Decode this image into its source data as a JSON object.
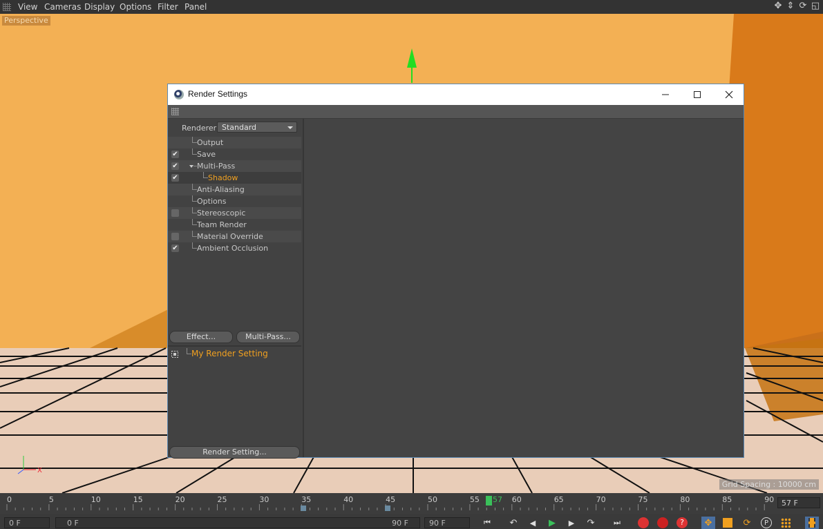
{
  "menu": {
    "items": [
      "View",
      "Cameras",
      "Display",
      "Options",
      "Filter",
      "Panel"
    ]
  },
  "viewport": {
    "camera_label": "Perspective",
    "grid_spacing": "Grid Spacing : 10000 cm",
    "axis_x": "X"
  },
  "dialog": {
    "title": "Render Settings",
    "renderer_label": "Renderer",
    "renderer_value": "Standard",
    "tree": [
      {
        "label": "Output",
        "check": "none"
      },
      {
        "label": "Save",
        "check": "on"
      },
      {
        "label": "Multi-Pass",
        "check": "on",
        "expanded": true
      },
      {
        "label": "Shadow",
        "check": "on",
        "child": true,
        "active": true
      },
      {
        "label": "Anti-Aliasing",
        "check": "none"
      },
      {
        "label": "Options",
        "check": "none"
      },
      {
        "label": "Stereoscopic",
        "check": "off"
      },
      {
        "label": "Team Render",
        "check": "none"
      },
      {
        "label": "Material Override",
        "check": "off"
      },
      {
        "label": "Ambient Occlusion",
        "check": "on"
      }
    ],
    "effect_button": "Effect...",
    "multipass_button": "Multi-Pass...",
    "setting_name": "My Render Setting",
    "render_setting_button": "Render Setting..."
  },
  "timeline": {
    "ticks": [
      "0",
      "5",
      "10",
      "15",
      "20",
      "25",
      "30",
      "35",
      "40",
      "45",
      "50",
      "55",
      "60",
      "65",
      "70",
      "75",
      "80",
      "85",
      "90"
    ],
    "current_frame": "57",
    "current_frame_field": "57 F"
  },
  "bottom": {
    "start_field": "0 F",
    "range_start": "0 F",
    "range_end": "90 F",
    "end_field": "90 F"
  },
  "colors": {
    "accent_orange": "#f0a020",
    "playhead_green": "#3ac05a",
    "wall": "#f3b054",
    "floor": "#e9cdb8"
  }
}
